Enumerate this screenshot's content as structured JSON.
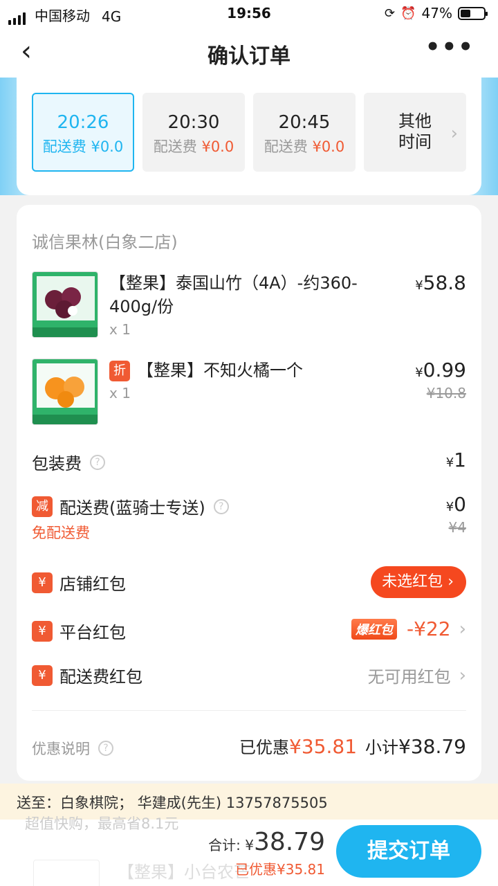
{
  "status": {
    "carrier": "中国移动",
    "network": "4G",
    "time": "19:56",
    "battery": "47%"
  },
  "nav": {
    "title": "确认订单",
    "back_icon": "‹",
    "more_icon": "•••"
  },
  "slots": [
    {
      "time": "20:26",
      "fee_label": "配送费",
      "fee": "¥0.0",
      "selected": true
    },
    {
      "time": "20:30",
      "fee_label": "配送费",
      "fee": "¥0.0"
    },
    {
      "time": "20:45",
      "fee_label": "配送费",
      "fee": "¥0.0"
    },
    {
      "line1": "其他",
      "line2": "时间"
    }
  ],
  "shop": "诚信果林(白象二店)",
  "items": [
    {
      "name": "【整果】泰国山竹（4A）-约360-400g/份",
      "qty": "x 1",
      "currency": "¥",
      "price": "58.8"
    },
    {
      "tag": "折",
      "name": "【整果】不知火橘一个",
      "qty": "x 1",
      "currency": "¥",
      "price": "0.99",
      "original": "¥10.8"
    }
  ],
  "packing": {
    "label": "包装费",
    "currency": "¥",
    "value": "1"
  },
  "delivery": {
    "tag": "减",
    "label": "配送费(蓝骑士专送)",
    "currency": "¥",
    "value": "0",
    "original": "¥4",
    "free": "免配送费"
  },
  "coupons": [
    {
      "icon": "¥",
      "label": "店铺红包",
      "action": "未选红包"
    },
    {
      "icon": "¥",
      "label": "平台红包",
      "badge": "爆红包",
      "value": "-¥22"
    },
    {
      "icon": "¥",
      "label": "配送费红包",
      "value": "无可用红包"
    }
  ],
  "summary": {
    "note": "优惠说明",
    "discount_label": "已优惠",
    "discount": "¥35.81",
    "subtotal_label": "小计",
    "subtotal": "¥38.79"
  },
  "address": "送至：白象棋院； 华建成(先生) 13757875505",
  "ghost": {
    "text": "超值快购，最高省8.1元",
    "item": "【整果】小台农芒"
  },
  "footer": {
    "total_label": "合计:",
    "currency": "¥",
    "total": "38.79",
    "saved": "已优惠¥35.81",
    "submit": "提交订单"
  },
  "colors": {
    "accent": "#1fb5f0",
    "red": "#f05a33"
  }
}
